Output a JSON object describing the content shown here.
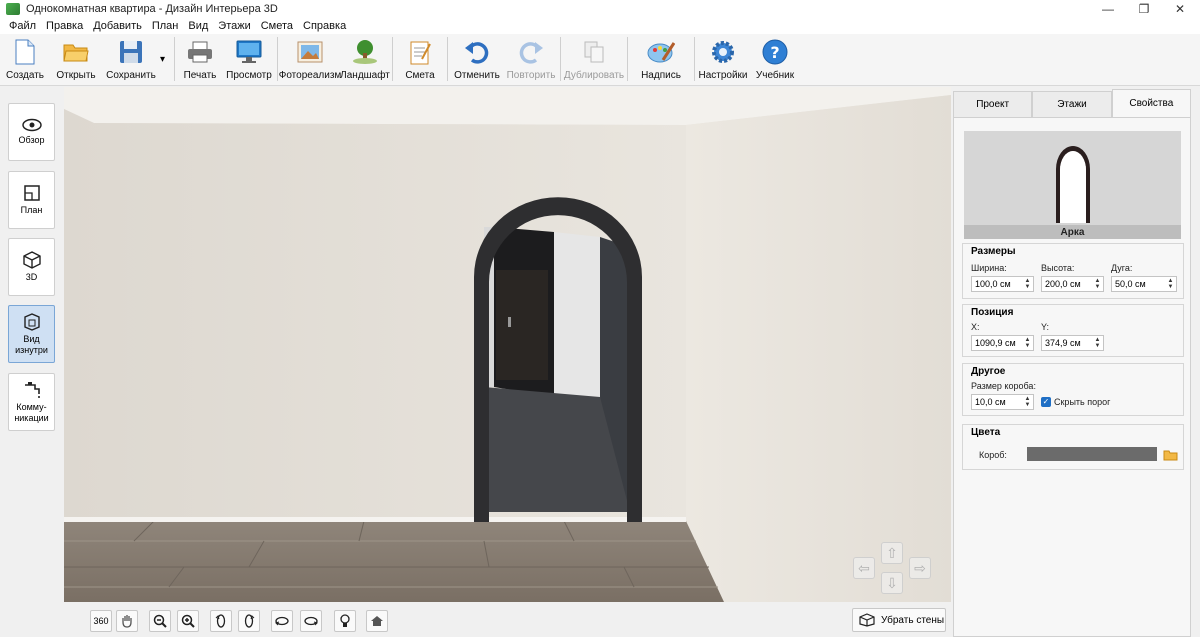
{
  "window": {
    "title": "Однокомнатная квартира - Дизайн Интерьера 3D",
    "minimize": "—",
    "maximize": "❐",
    "close": "✕"
  },
  "menu": [
    "Файл",
    "Правка",
    "Добавить",
    "План",
    "Вид",
    "Этажи",
    "Смета",
    "Справка"
  ],
  "toolbar": {
    "create": "Создать",
    "open": "Открыть",
    "save": "Сохранить",
    "save_dropdown": "▾",
    "print": "Печать",
    "preview": "Просмотр",
    "photorealism": "Фотореализм",
    "landscape": "Ландшафт",
    "estimate": "Смета",
    "undo": "Отменить",
    "redo": "Повторить",
    "duplicate": "Дублировать",
    "label": "Надпись",
    "settings": "Настройки",
    "tutorial": "Учебник"
  },
  "sidebar": {
    "overview": "Обзор",
    "plan": "План",
    "view3d": "3D",
    "inside_view": "Вид изнутри",
    "utilities": "Комму-\nникации"
  },
  "bottombar": {
    "btn360": "360",
    "remove_walls": "Убрать стены"
  },
  "panel": {
    "tabs": [
      "Проект",
      "Этажи",
      "Свойства"
    ],
    "active_tab": "Свойства",
    "object_name": "Арка",
    "sizes_title": "Размеры",
    "width_label": "Ширина:",
    "width_value": "100,0 см",
    "height_label": "Высота:",
    "height_value": "200,0 см",
    "arc_label": "Дуга:",
    "arc_value": "50,0 см",
    "position_title": "Позиция",
    "x_label": "X:",
    "x_value": "1090,9 см",
    "y_label": "Y:",
    "y_value": "374,9 см",
    "other_title": "Другое",
    "frame_size_label": "Размер короба:",
    "frame_size_value": "10,0 см",
    "hide_threshold_label": "Скрыть порог",
    "hide_threshold_checked": true,
    "colors_title": "Цвета",
    "frame_color_label": "Короб:",
    "frame_color": "#6b6b6b"
  },
  "colors": {
    "accent": "#1f6fc5",
    "active_side": "#cfe0f3"
  }
}
